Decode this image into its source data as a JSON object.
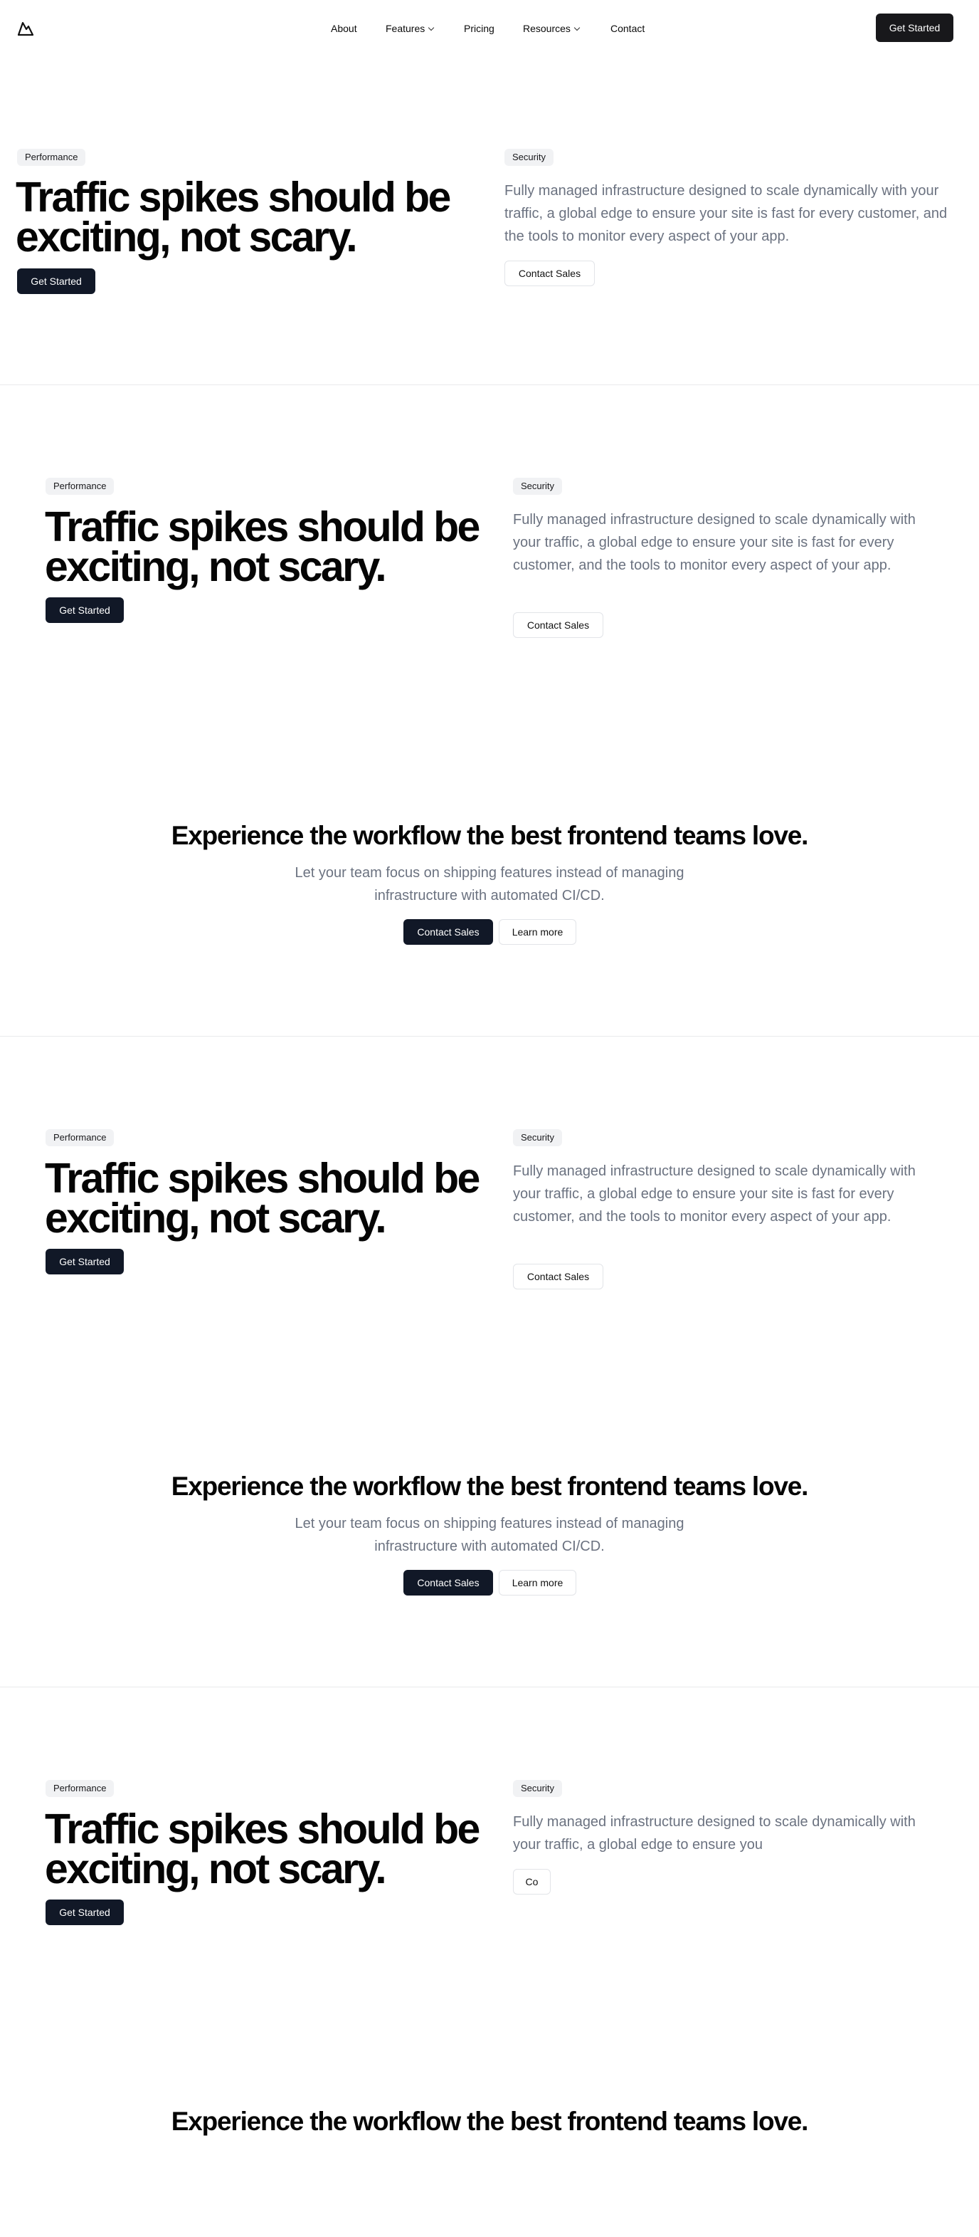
{
  "nav": {
    "logo": "mountain-logo",
    "links": [
      "About",
      "Features",
      "Pricing",
      "Resources",
      "Contact"
    ],
    "cta": "Get Started"
  },
  "sections": [
    {
      "left_badge": "Performance",
      "title_line1": "Traffic spikes should be",
      "title_line2": "exciting, not scary.",
      "left_button": "Get Started",
      "right_badge": "Security",
      "paragraph": "Fully managed infrastructure designed to scale dynamically with your traffic, a global edge to ensure your site is fast for every customer, and the tools to monitor every aspect of your app.",
      "right_button": "Contact Sales"
    },
    {
      "left_badge": "Performance",
      "title_line1": "Traffic spikes should be",
      "title_line2": "exciting, not scary.",
      "left_button": "Get Started",
      "right_badge": "Security",
      "paragraph": "Fully managed infrastructure designed to scale dynamically with your traffic, a global edge to ensure your site is fast for every customer, and the tools to monitor every aspect of your app.",
      "right_button": "Contact Sales"
    },
    {
      "left_badge": "Performance",
      "title_line1": "Traffic spikes should be",
      "title_line2": "exciting, not scary.",
      "left_button": "Get Started",
      "right_badge": "Security",
      "paragraph": "Fully managed infrastructure designed to scale dynamically with your traffic, a global edge to ensure your site is fast for every customer, and the tools to monitor every aspect of your app.",
      "right_button": "Contact Sales"
    },
    {
      "left_badge": "Performance",
      "title_line1": "Traffic spikes should be",
      "title_line2": "exciting, not scary.",
      "left_button": "Get Started",
      "right_badge": "Security",
      "paragraph": "Fully managed infrastructure designed to scale dynamically with your traffic, a global edge to ensure you",
      "right_button": "Co"
    }
  ],
  "ctas": [
    {
      "title": "Experience the workflow the best frontend teams love.",
      "subtitle": "Let your team focus on shipping features instead of managing infrastructure with automated CI/CD.",
      "primary": "Contact Sales",
      "secondary": "Learn more"
    },
    {
      "title": "Experience the workflow the best frontend teams love.",
      "subtitle": "Let your team focus on shipping features instead of managing infrastructure with automated CI/CD.",
      "primary": "Contact Sales",
      "secondary": "Learn more"
    },
    {
      "title": "Experience the workflow the best frontend teams love."
    }
  ]
}
